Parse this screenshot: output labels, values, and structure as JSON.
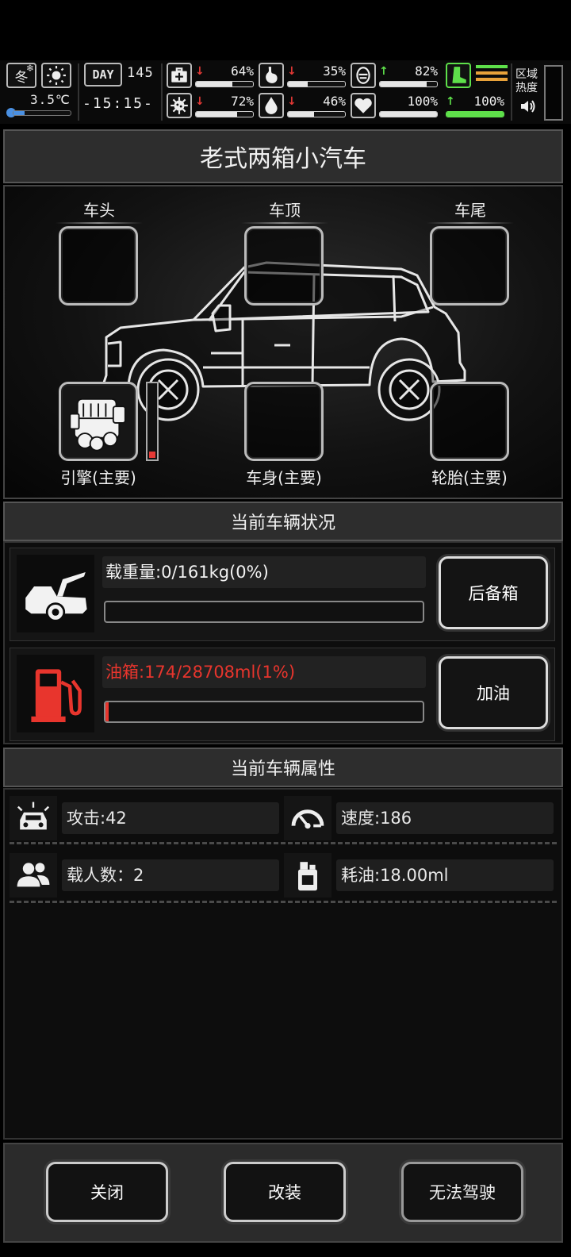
{
  "hud": {
    "season": "冬",
    "temperature": "3.5℃",
    "day_label": "DAY",
    "day_number": "145",
    "clock": "-15:15-",
    "stats": [
      {
        "name": "health",
        "icon": "medkit-icon",
        "trend": "down",
        "arrow": "↓",
        "value": "64%",
        "fraction": 0.64
      },
      {
        "name": "hunger",
        "icon": "stomach-icon",
        "trend": "down",
        "arrow": "↓",
        "value": "35%",
        "fraction": 0.35
      },
      {
        "name": "mood",
        "icon": "face-icon",
        "trend": "up",
        "arrow": "↑",
        "value": "82%",
        "fraction": 0.82
      },
      {
        "name": "virus",
        "icon": "virus-icon",
        "trend": "down",
        "arrow": "↓",
        "value": "72%",
        "fraction": 0.72
      },
      {
        "name": "thirst",
        "icon": "water-drop-icon",
        "trend": "down",
        "arrow": "↓",
        "value": "46%",
        "fraction": 0.46
      },
      {
        "name": "heart",
        "icon": "heart-icon",
        "trend": "none",
        "arrow": "",
        "value": "100%",
        "fraction": 1.0
      },
      {
        "name": "stamina",
        "icon": "boot-icon",
        "trend": "up",
        "arrow": "↑",
        "value": "100%",
        "fraction": 1.0
      }
    ],
    "region_heat_label": "区域\n热度"
  },
  "vehicle": {
    "name": "老式两箱小汽车",
    "slots": {
      "front": "车头",
      "roof": "车顶",
      "rear": "车尾",
      "engine": "引擎(主要)",
      "body": "车身(主要)",
      "tires": "轮胎(主要)"
    },
    "engine_level": 0.08
  },
  "status": {
    "title": "当前车辆状况",
    "load_text": "载重量:0/161kg(0%)",
    "load_fraction": 0.0,
    "trunk_button": "后备箱",
    "fuel_text": "油箱:174/28708ml(1%)",
    "fuel_fraction": 0.01,
    "refuel_button": "加油"
  },
  "attributes": {
    "title": "当前车辆属性",
    "attack": "攻击:42",
    "speed": "速度:186",
    "passengers": "载人数：2",
    "fuel_consumption": "耗油:18.00ml"
  },
  "footer": {
    "close": "关闭",
    "modify": "改装",
    "drive": "无法驾驶"
  },
  "colors": {
    "accent_red": "#e53935",
    "accent_green": "#5ee04a",
    "fuel_red": "#e8352d"
  }
}
